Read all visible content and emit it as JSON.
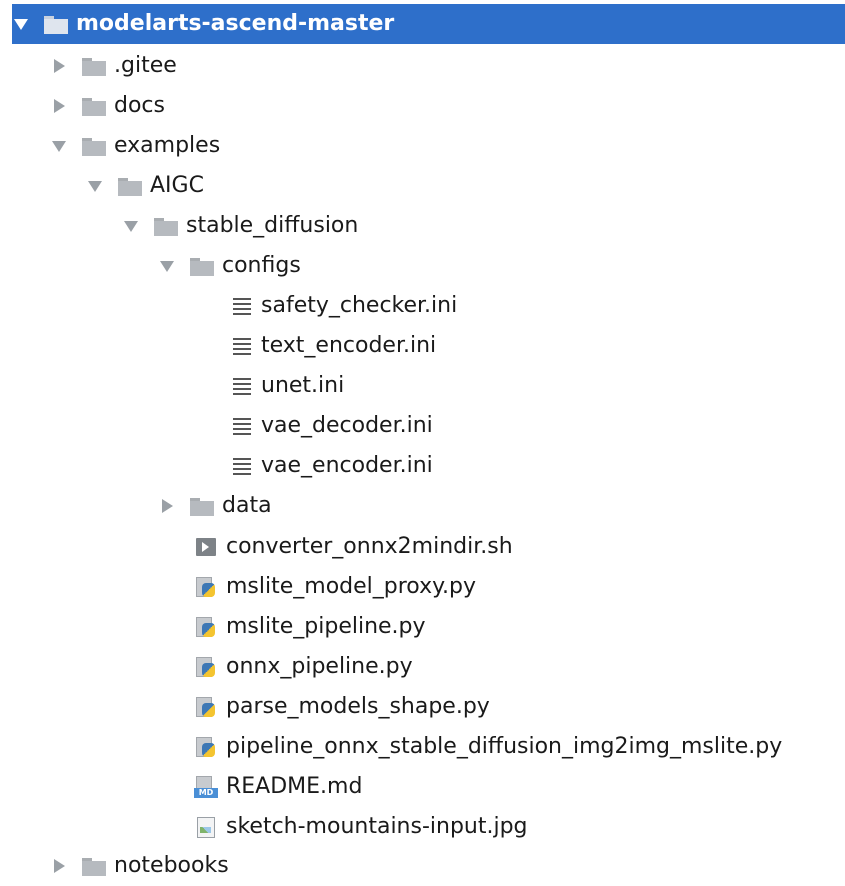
{
  "tree": {
    "root": "modelarts-ascend-master",
    "items": [
      ".gitee",
      "docs",
      "examples",
      "AIGC",
      "stable_diffusion",
      "configs",
      "safety_checker.ini",
      "text_encoder.ini",
      "unet.ini",
      "vae_decoder.ini",
      "vae_encoder.ini",
      "data",
      "converter_onnx2mindir.sh",
      "mslite_model_proxy.py",
      "mslite_pipeline.py",
      "onnx_pipeline.py",
      "parse_models_shape.py",
      "pipeline_onnx_stable_diffusion_img2img_mslite.py",
      "README.md",
      "sketch-mountains-input.jpg",
      "notebooks"
    ]
  },
  "icons": {
    "folder": "folder-icon",
    "ini": "text-file-icon",
    "shell": "shell-script-icon",
    "python": "python-file-icon",
    "markdown": "markdown-file-icon",
    "image": "image-file-icon",
    "expanded": "chevron-down-icon",
    "collapsed": "chevron-right-icon"
  },
  "colors": {
    "selection": "#2e6fca",
    "text": "#1a1a1a",
    "folder": "#b6babf"
  }
}
